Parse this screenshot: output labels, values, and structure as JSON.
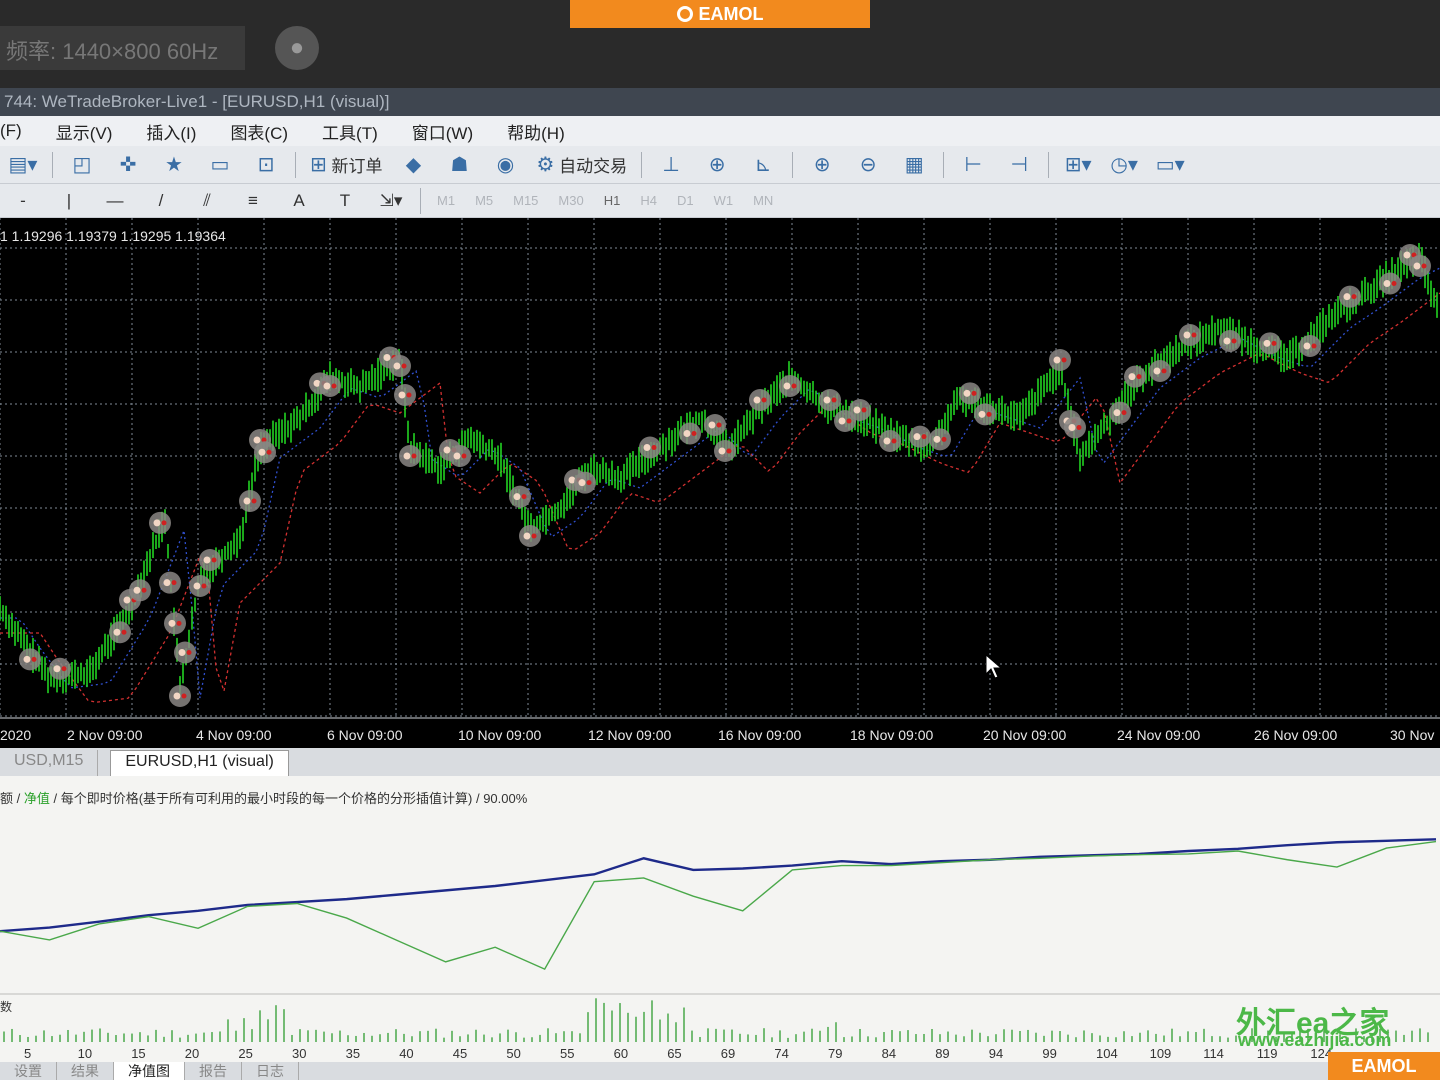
{
  "banner": {
    "brand": "EAMOL",
    "monitor_info": "频率: 1440×800 60Hz"
  },
  "window": {
    "title": "744: WeTradeBroker-Live1 - [EURUSD,H1 (visual)]"
  },
  "menu": {
    "items": [
      "(F)",
      "显示(V)",
      "插入(I)",
      "图表(C)",
      "工具(T)",
      "窗口(W)",
      "帮助(H)"
    ]
  },
  "toolbar1": {
    "new_order": "新订单",
    "auto_trade": "自动交易"
  },
  "toolbar2": {
    "text_tool": "A",
    "timeframes": [
      "M1",
      "M5",
      "M15",
      "M30",
      "H1",
      "H4",
      "D1",
      "W1",
      "MN"
    ],
    "active_timeframe": "H1"
  },
  "chart": {
    "ohlc": "1  1.19296 1.19379 1.19295 1.19364",
    "time_labels": [
      "2020",
      "2 Nov 09:00",
      "4 Nov 09:00",
      "6 Nov 09:00",
      "10 Nov 09:00",
      "12 Nov 09:00",
      "16 Nov 09:00",
      "18 Nov 09:00",
      "20 Nov 09:00",
      "24 Nov 09:00",
      "26 Nov 09:00",
      "30 Nov"
    ],
    "colors": {
      "background": "#000000",
      "grid": "#7f8a96",
      "candles": "#22d322",
      "trade_marker": "#f2d6c4",
      "ma_red": "#d23030",
      "ma_blue": "#3050d0"
    }
  },
  "chart_tabs": {
    "tab1": "USD,M15",
    "tab2": "EURUSD,H1 (visual)"
  },
  "report": {
    "caption_prefix": "额 / ",
    "caption_equity": "净值",
    "caption_rest": " / 每个即时价格(基于所有可利用的最小时段的每一个价格的分形插值计算) / 90.00%",
    "volume_label": "数",
    "x_ticks": [
      "5",
      "10",
      "15",
      "20",
      "25",
      "30",
      "35",
      "40",
      "45",
      "50",
      "55",
      "60",
      "65",
      "69",
      "74",
      "79",
      "84",
      "89",
      "94",
      "99",
      "104",
      "109",
      "114",
      "119",
      "124"
    ],
    "colors": {
      "balance": "#1e2a8a",
      "equity": "#4aa84a",
      "volume": "#4aa84a"
    }
  },
  "chart_data": [
    {
      "type": "line",
      "series": [
        {
          "name": "余额",
          "values": [
            0.82,
            0.87,
            0.95,
            1.04,
            1.1,
            1.18,
            1.22,
            1.26,
            1.32,
            1.38,
            1.44,
            1.52,
            1.6,
            1.82,
            1.66,
            1.68,
            1.72,
            1.78,
            1.74,
            1.78,
            1.8,
            1.84,
            1.86,
            1.88,
            1.92,
            1.95,
            2.0,
            2.04,
            2.06,
            2.08
          ]
        },
        {
          "name": "净值",
          "values": [
            0.82,
            0.7,
            0.92,
            1.02,
            0.86,
            1.16,
            1.2,
            1.0,
            0.7,
            0.4,
            0.6,
            0.3,
            1.5,
            1.55,
            1.3,
            1.1,
            1.66,
            1.72,
            1.72,
            1.76,
            1.8,
            1.82,
            1.85,
            1.87,
            1.88,
            1.92,
            1.8,
            1.7,
            1.96,
            2.05
          ]
        }
      ]
    }
  ],
  "bottom_tabs": [
    "设置",
    "结果",
    "净值图",
    "报告",
    "日志"
  ],
  "watermark": {
    "text": "外汇ea之家",
    "url": "www.eazhijia.com"
  }
}
